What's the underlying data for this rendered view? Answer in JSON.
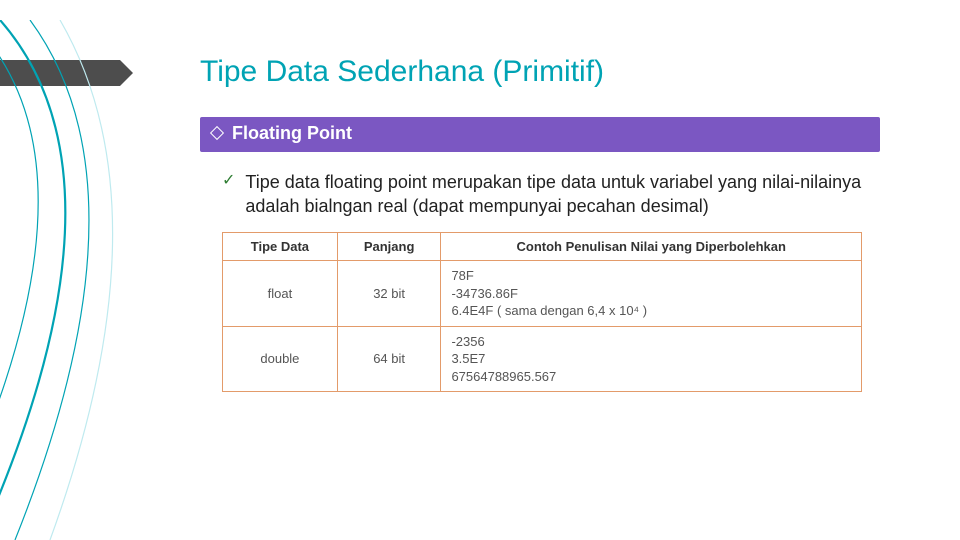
{
  "title": "Tipe Data Sederhana (Primitif)",
  "subheading": "Floating Point",
  "bullet": "Tipe data floating point merupakan tipe data untuk variabel yang nilai-nilainya adalah bialngan real (dapat mempunyai pecahan desimal)",
  "table": {
    "headers": {
      "col1": "Tipe Data",
      "col2": "Panjang",
      "col3": "Contoh Penulisan Nilai yang Diperbolehkan"
    },
    "rows": [
      {
        "type": "float",
        "length": "32 bit",
        "ex1": "78F",
        "ex2": "-34736.86F",
        "ex3": "6.4E4F ( sama dengan 6,4 x 10⁴ )"
      },
      {
        "type": "double",
        "length": "64 bit",
        "ex1": "-2356",
        "ex2": "3.5E7",
        "ex3": "67564788965.567"
      }
    ]
  }
}
